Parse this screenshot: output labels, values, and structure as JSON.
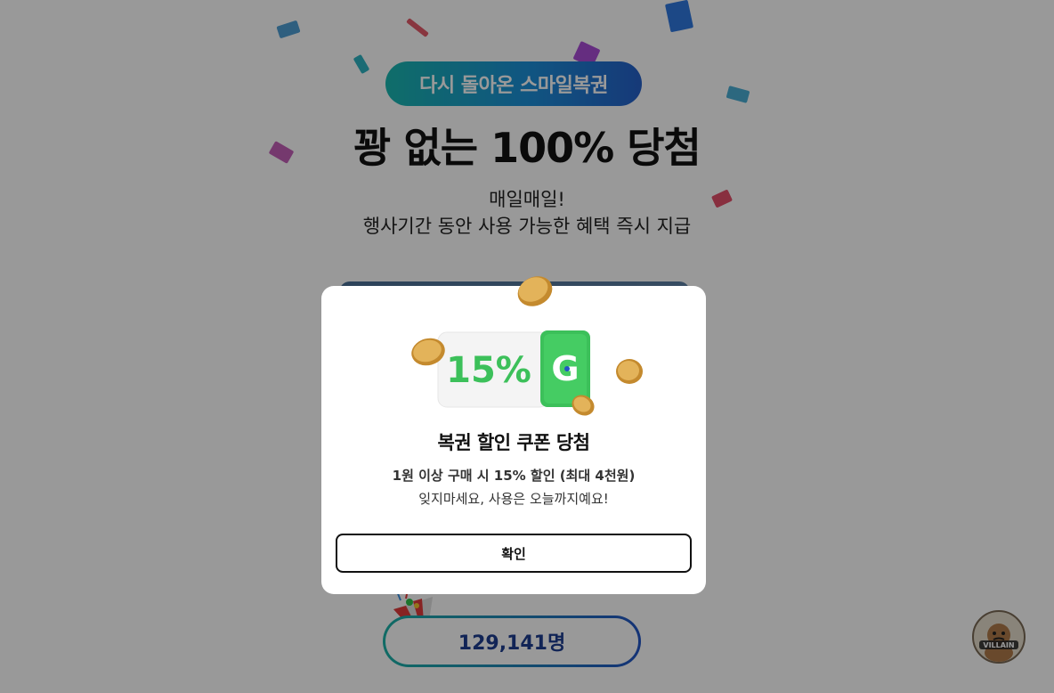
{
  "event": {
    "pill_label": "다시 돌아온 스마일복권",
    "headline": "꽝 없는 100% 당첨",
    "sub_line1": "매일매일!",
    "sub_line2": "행사기간 동안 사용 가능한 혜택 즉시 지급",
    "participant_count": "129,141명",
    "villain_badge_text": "VILLAIN"
  },
  "modal": {
    "coupon_percent": "15%",
    "coupon_logo_letter": "G",
    "title": "복권 할인 쿠폰 당첨",
    "description": "1원 이상 구매 시 15% 할인 (최대 4천원)",
    "note": "잊지마세요, 사용은 오늘까지예요!",
    "confirm_label": "확인"
  },
  "colors": {
    "pill_gradient_start": "#19b7b0",
    "pill_gradient_end": "#2560c9",
    "coupon_green": "#3cc05a",
    "counter_text": "#1d3d8f",
    "coin_gold": "#d6a64a"
  },
  "icons": [
    "coin-icon",
    "party-horn-icon",
    "villain-mascot-icon",
    "g-logo-icon"
  ]
}
